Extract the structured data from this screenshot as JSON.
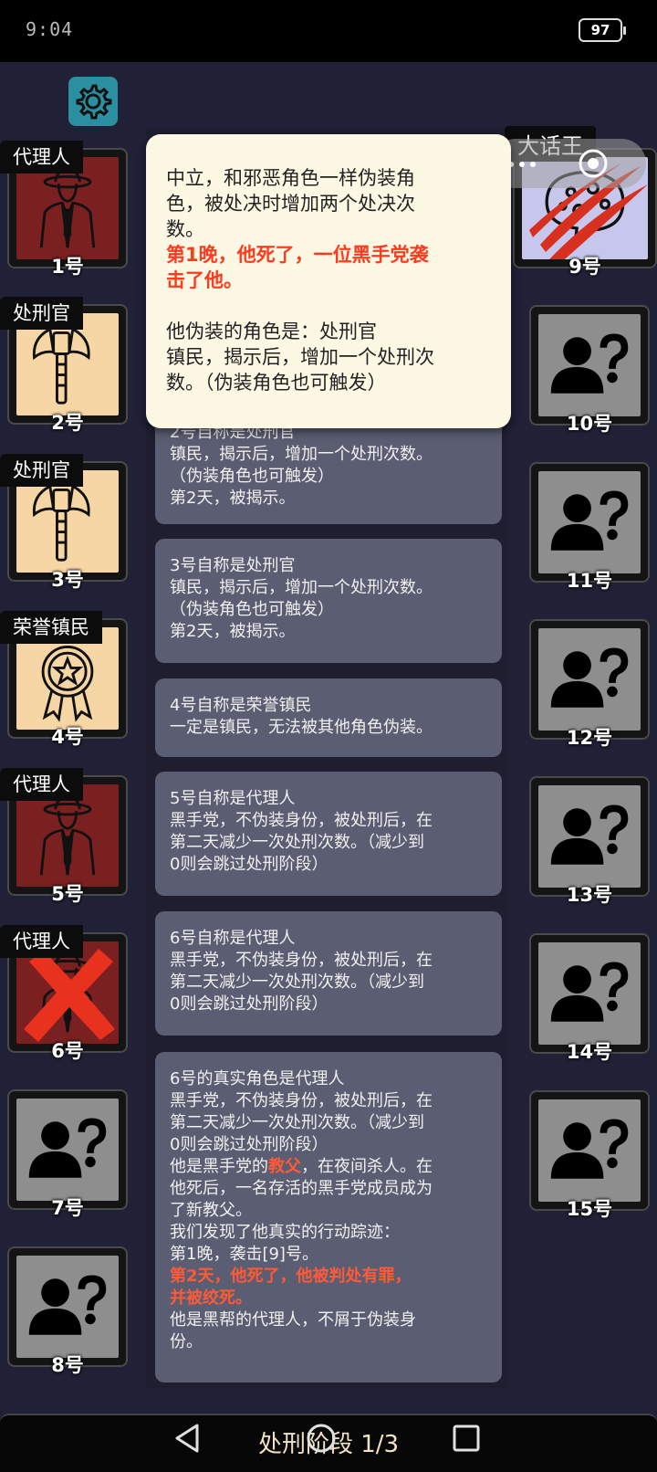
{
  "status_bar": {
    "time": "9:04",
    "battery": "97"
  },
  "settings_icon": "gear-icon",
  "left_seats": [
    {
      "role": "代理人",
      "number": "1号",
      "icon": "fedora-suit-icon",
      "theme": "red"
    },
    {
      "role": "处刑官",
      "number": "2号",
      "icon": "axe-icon",
      "theme": "tan"
    },
    {
      "role": "处刑官",
      "number": "3号",
      "icon": "axe-icon",
      "theme": "tan"
    },
    {
      "role": "荣誉镇民",
      "number": "4号",
      "icon": "medal-icon",
      "theme": "tan"
    },
    {
      "role": "代理人",
      "number": "5号",
      "icon": "fedora-suit-icon",
      "theme": "red"
    },
    {
      "role": "代理人",
      "number": "6号",
      "icon": "fedora-suit-icon",
      "theme": "red",
      "dead": true
    },
    {
      "role": "",
      "number": "7号",
      "icon": "unknown-person-icon",
      "theme": "gray"
    },
    {
      "role": "",
      "number": "8号",
      "icon": "unknown-person-icon",
      "theme": "gray"
    }
  ],
  "right_seats": [
    {
      "role": "大话王",
      "number": "9号",
      "icon": "speech-bubble-icon",
      "theme": "lav",
      "attacked": true
    },
    {
      "role": "",
      "number": "10号",
      "icon": "unknown-person-icon",
      "theme": "gray"
    },
    {
      "role": "",
      "number": "11号",
      "icon": "unknown-person-icon",
      "theme": "gray"
    },
    {
      "role": "",
      "number": "12号",
      "icon": "unknown-person-icon",
      "theme": "gray"
    },
    {
      "role": "",
      "number": "13号",
      "icon": "unknown-person-icon",
      "theme": "gray"
    },
    {
      "role": "",
      "number": "14号",
      "icon": "unknown-person-icon",
      "theme": "gray"
    },
    {
      "role": "",
      "number": "15号",
      "icon": "unknown-person-icon",
      "theme": "gray"
    }
  ],
  "popup": {
    "desc_lines": [
      "中立，和邪恶角色一样伪装角",
      "色，被处决时增加两个处决次",
      "数。"
    ],
    "death_lines": [
      "第1晚，他死了，一位黑手党袭",
      "击了他。"
    ],
    "disguise_lines": [
      "他伪装的角色是：处刑官",
      "镇民，揭示后，增加一个处刑次",
      "数。（伪装角色也可触发）"
    ]
  },
  "cards": [
    {
      "lines": [
        "2号自称是处刑官",
        "镇民，揭示后，增加一个处刑次数。",
        "（伪装角色也可触发）",
        "第2天，被揭示。"
      ]
    },
    {
      "lines": [
        "3号自称是处刑官",
        "镇民，揭示后，增加一个处刑次数。",
        "（伪装角色也可触发）",
        "第2天，被揭示。"
      ]
    },
    {
      "lines": [
        "4号自称是荣誉镇民",
        "一定是镇民，无法被其他角色伪装。"
      ]
    },
    {
      "lines": [
        "5号自称是代理人",
        "黑手党，不伪装身份，被处刑后，在",
        "第二天减少一次处刑次数。（减少到",
        "0则会跳过处刑阶段）"
      ]
    },
    {
      "lines": [
        "6号自称是代理人",
        "黑手党，不伪装身份，被处刑后，在",
        "第二天减少一次处刑次数。（减少到",
        "0则会跳过处刑阶段）"
      ]
    },
    {
      "lines": [
        "6号的真实角色是代理人",
        "黑手党，不伪装身份，被处刑后，在",
        "第二天减少一次处刑次数。（减少到",
        "0则会跳过处刑阶段）"
      ],
      "godfather": {
        "pre": "他是黑手党的",
        "hl": "教父",
        "post": "，在夜间杀人。在"
      },
      "after_lines": [
        "他死后，一名存活的黑手党成员成为",
        "了新教父。",
        "我们发现了他真实的行动踪迹：",
        "第1晚，袭击[9]号。"
      ],
      "death_lines": [
        "第2天，他死了，他被判处有罪，",
        "并被绞死。"
      ],
      "final_lines": [
        "他是黑帮的代理人，不屑于伪装身",
        "份。"
      ]
    }
  ],
  "phase": {
    "label": "处刑阶段 1/3"
  },
  "nav": {
    "back": "back-icon",
    "home": "home-icon",
    "recents": "recents-icon"
  }
}
